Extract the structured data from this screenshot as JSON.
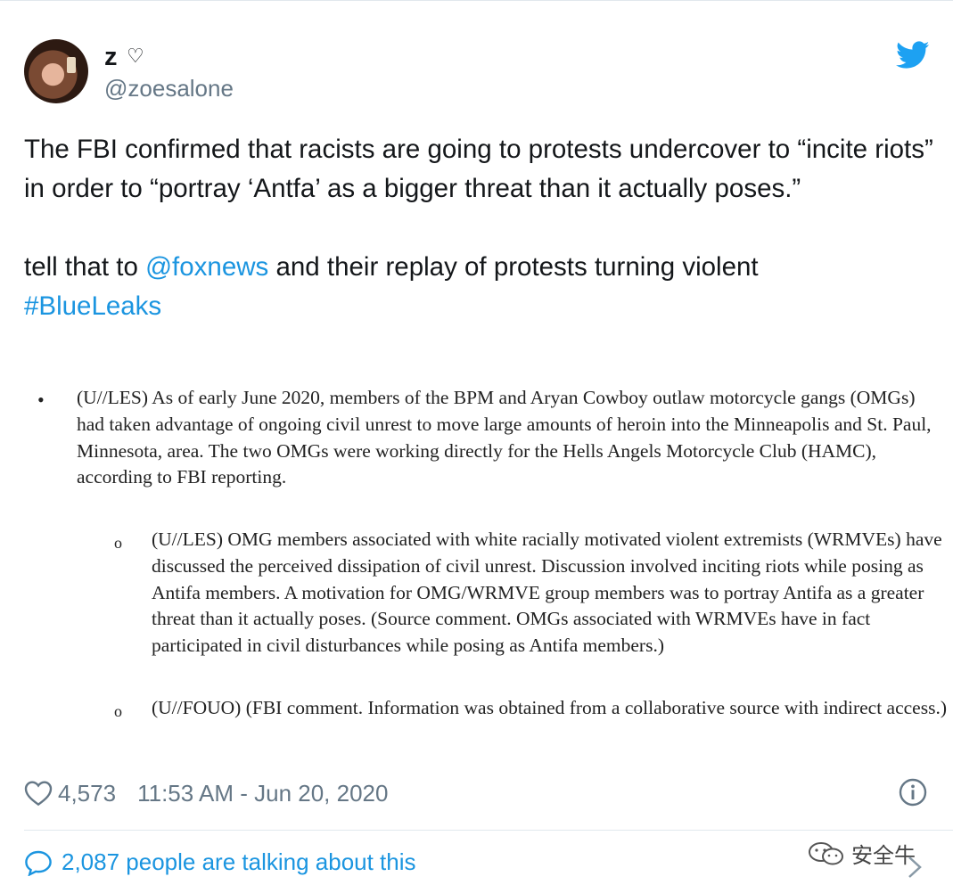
{
  "user": {
    "name": "z",
    "name_emoji": "♡",
    "handle": "@zoesalone"
  },
  "tweet": {
    "text_p1": "The FBI confirmed that racists are going to protests undercover to “incite riots” in order to “portray ‘Antfa’ as a bigger threat than it actually poses.”",
    "text_p2_pre": "tell that to ",
    "mention": "@foxnews",
    "text_p2_post": " and their replay of protests turning violent",
    "hashtag": "#BlueLeaks"
  },
  "document": {
    "para1": "(U//LES) As of early June 2020, members of the BPM and Aryan Cowboy outlaw motorcycle gangs (OMGs) had taken advantage of ongoing civil unrest to move large amounts of heroin into the Minneapolis and St. Paul, Minnesota, area. The two OMGs were working directly for the Hells Angels Motorcycle Club (HAMC), according to FBI reporting.",
    "para2": "(U//LES) OMG members associated with white racially motivated violent extremists (WRMVEs) have discussed the perceived dissipation of civil unrest. Discussion involved inciting riots while posing as Antifa members. A motivation for OMG/WRMVE group members was to portray Antifa as a greater threat than it actually poses. (Source comment. OMGs associated with WRMVEs have in fact participated in civil disturbances while posing as Antifa members.)",
    "para3": "(U//FOUO) (FBI comment. Information was obtained from a collaborative source with indirect access.)",
    "bullet": "•",
    "sub_bullet": "o"
  },
  "meta": {
    "likes": "4,573",
    "timestamp": "11:53 AM - Jun 20, 2020"
  },
  "conversation": {
    "label": "2,087 people are talking about this"
  },
  "watermark": {
    "text": "安全牛"
  },
  "colors": {
    "link": "#1b95e0",
    "twitter_blue": "#1da1f2",
    "secondary": "#657786"
  },
  "icons": [
    "twitter-bird-icon",
    "heart-icon",
    "info-icon",
    "speech-bubble-icon",
    "chevron-right-icon"
  ]
}
